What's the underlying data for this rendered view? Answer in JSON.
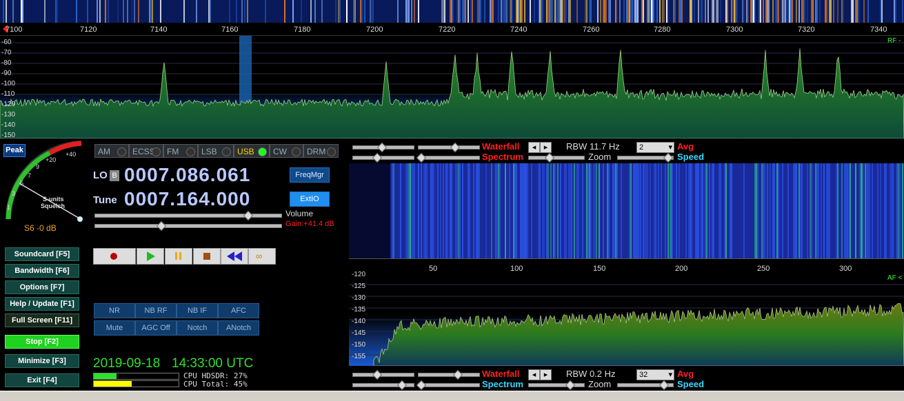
{
  "top": {
    "freq_ticks": [
      "7100",
      "7120",
      "7140",
      "7160",
      "7180",
      "7200",
      "7220",
      "7240",
      "7260",
      "7280",
      "7300",
      "7320",
      "7340"
    ],
    "db_ticks": [
      "-60",
      "-70",
      "-80",
      "-90",
      "-100",
      "-110",
      "-120",
      "-130",
      "-140",
      "-150"
    ],
    "rf_label": "RF -"
  },
  "meter": {
    "peak_label": "Peak",
    "scale": [
      "1",
      "3",
      "5",
      "7",
      "9",
      "+20",
      "+40"
    ],
    "s_units": "S-units",
    "squelch": "Squelch",
    "reading": "S6 -0 dB"
  },
  "modes": [
    {
      "label": "AM",
      "active": false
    },
    {
      "label": "ECSS",
      "active": false
    },
    {
      "label": "FM",
      "active": false
    },
    {
      "label": "LSB",
      "active": false
    },
    {
      "label": "USB",
      "active": true
    },
    {
      "label": "CW",
      "active": false
    },
    {
      "label": "DRM",
      "active": false
    }
  ],
  "lo": {
    "label": "LO",
    "badge": "B",
    "value": "0007.086.061",
    "button": "FreqMgr"
  },
  "tune": {
    "label": "Tune",
    "value": "0007.164.000",
    "button": "ExtIO"
  },
  "volume": {
    "label": "Volume",
    "gain": "Gain:+41.4 dB"
  },
  "function_buttons": [
    "Soundcard  [F5]",
    "Bandwidth  [F6]",
    "Options  [F7]",
    "Help / Update  [F1]",
    "Full Screen  [F11]",
    "Stop  [F2]",
    "Minimize  [F3]",
    "Exit  [F4]"
  ],
  "dsp_buttons": [
    "NR",
    "NB RF",
    "NB IF",
    "AFC",
    "Mute",
    "AGC Off",
    "Notch",
    "ANotch"
  ],
  "status": {
    "date": "2019-09-18",
    "time": "14:33:00 UTC",
    "cpu_hdsdr": "CPU HDSDR: 27%",
    "cpu_total": "CPU Total: 45%",
    "cpu_hdsdr_level": 0.27,
    "cpu_total_level": 0.45
  },
  "rf_controls": {
    "waterfall": "Waterfall",
    "spectrum": "Spectrum",
    "rbw": "RBW 11.7 Hz",
    "avg_value": "2",
    "avg": "Avg",
    "zoom": "Zoom",
    "speed": "Speed"
  },
  "af": {
    "axis_ticks": [
      "50",
      "100",
      "150",
      "200",
      "250",
      "300"
    ],
    "db_ticks": [
      "-120",
      "-125",
      "-130",
      "-135",
      "-140",
      "-145",
      "-150",
      "-155"
    ],
    "label": "AF <"
  },
  "af_controls": {
    "waterfall": "Waterfall",
    "spectrum": "Spectrum",
    "rbw": "RBW  0.2 Hz",
    "avg_value": "32",
    "avg": "Avg",
    "zoom": "Zoom",
    "speed": "Speed"
  },
  "colors": {
    "accent_red": "#ff2020",
    "accent_cyan": "#38d8ff",
    "freq_blue": "#b9c8ff",
    "date_green": "#2ee02e"
  }
}
